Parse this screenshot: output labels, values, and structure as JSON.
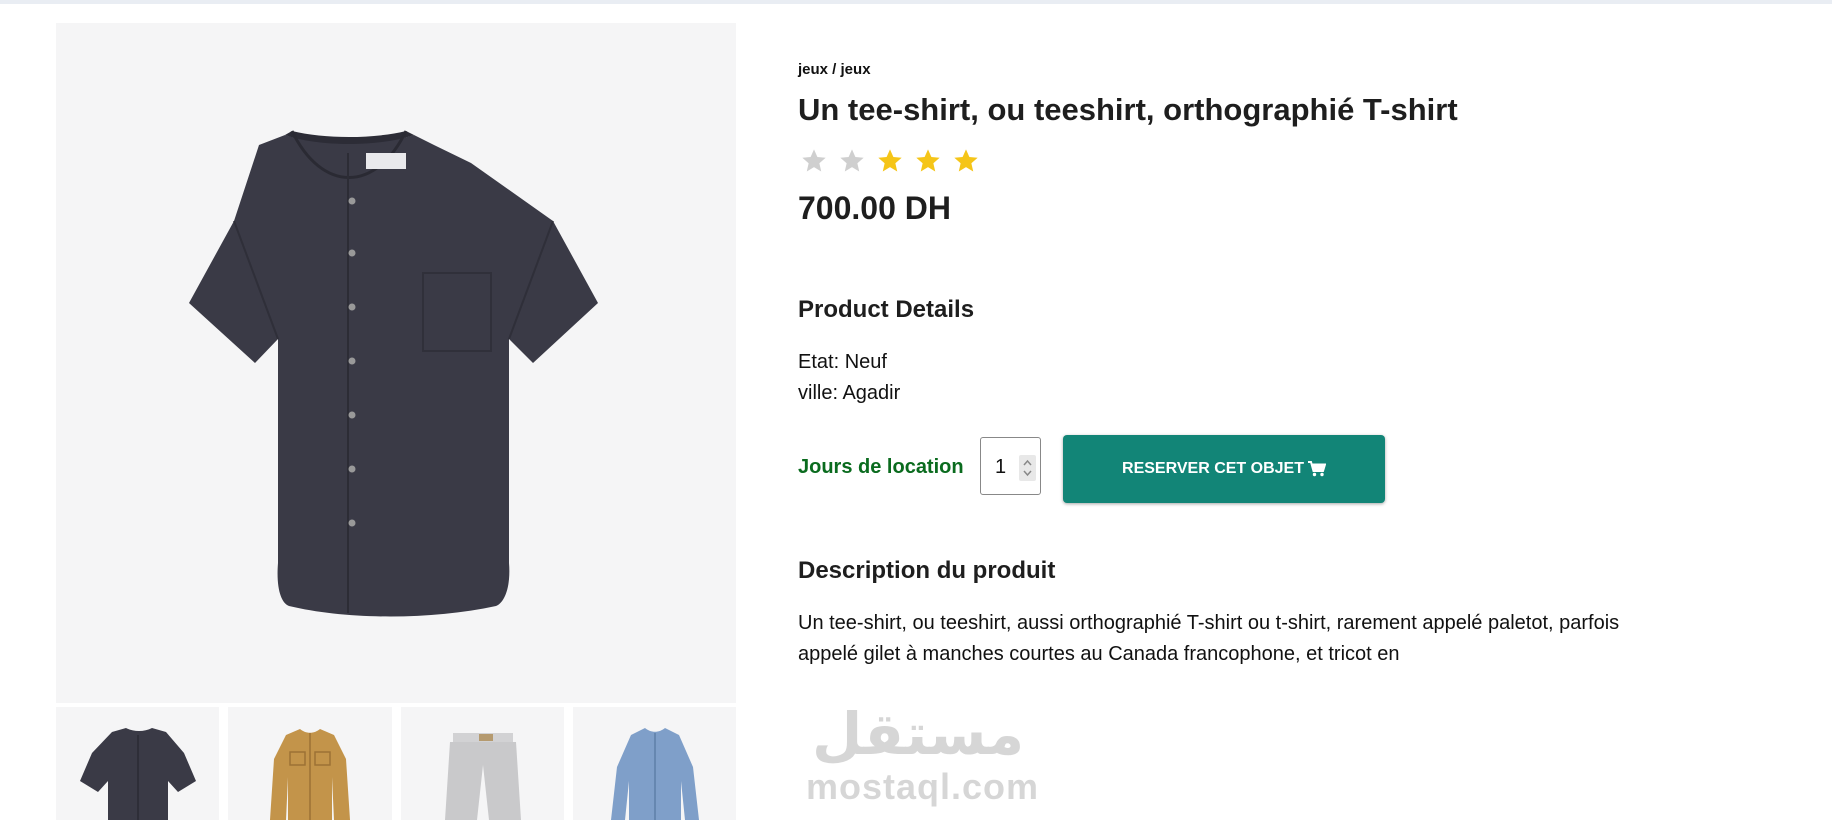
{
  "breadcrumb": "jeux / jeux",
  "product": {
    "title": "Un tee-shirt, ou teeshirt, orthographié T-shirt",
    "rating": 3,
    "rating_max": 5,
    "price": "700.00 DH"
  },
  "details": {
    "heading": "Product Details",
    "etat": "Etat: Neuf",
    "ville": "ville: Agadir"
  },
  "rental": {
    "label": "Jours de location",
    "quantity": "1",
    "button_label": "RESERVER CET OBJET"
  },
  "description": {
    "heading": "Description du produit",
    "text": "Un tee-shirt, ou teeshirt, aussi orthographié T-shirt ou t-shirt, rarement appelé paletot, parfois appelé gilet à manches courtes au Canada francophone, et tricot en"
  },
  "watermark": {
    "arabic": "مستقل",
    "latin": "mostaql.com"
  },
  "colors": {
    "accent": "#128577",
    "label_green": "#0a6b1e",
    "star_filled": "#f5c518",
    "star_empty": "#cfcfcf"
  },
  "icons": [
    "cart-icon",
    "star-icon",
    "spinner-arrows-icon"
  ]
}
